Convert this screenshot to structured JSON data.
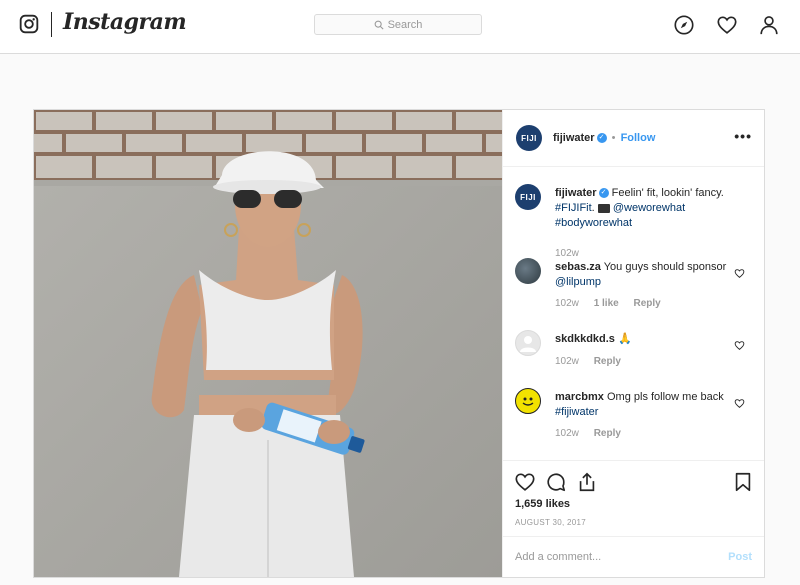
{
  "header": {
    "brand": "Instagram",
    "search_placeholder": "Search",
    "icons": [
      "instagram-logo-icon",
      "search-icon",
      "compass-icon",
      "heart-icon",
      "profile-icon"
    ]
  },
  "post": {
    "author": "fijiwater",
    "avatar_text": "FIJI",
    "follow_label": "Follow",
    "more_label": "•••",
    "caption": {
      "username": "fijiwater",
      "text": "Feelin' fit, lookin' fancy.",
      "hashtag1": "#FIJIFit",
      "mention": "@weworewhat",
      "hashtag2": "#bodyworewhat",
      "time": "102w"
    },
    "comments": [
      {
        "username": "sebas.za",
        "text": "You guys should sponsor",
        "mention": "@lilpump",
        "time": "102w",
        "likes": "1 like",
        "reply": "Reply"
      },
      {
        "username": "skdkkdkd.s",
        "text": "🙏",
        "time": "102w",
        "reply": "Reply"
      },
      {
        "username": "marcbmx",
        "text": "Omg pls follow me back",
        "hashtag": "#fijiwater",
        "time": "102w",
        "reply": "Reply"
      }
    ],
    "likes": "1,659 likes",
    "date": "AUGUST 30, 2017",
    "add_comment_placeholder": "Add a comment...",
    "post_label": "Post"
  },
  "colors": {
    "link": "#003569",
    "accent": "#3897f0",
    "muted": "#999999",
    "border": "#dbdbdb"
  }
}
